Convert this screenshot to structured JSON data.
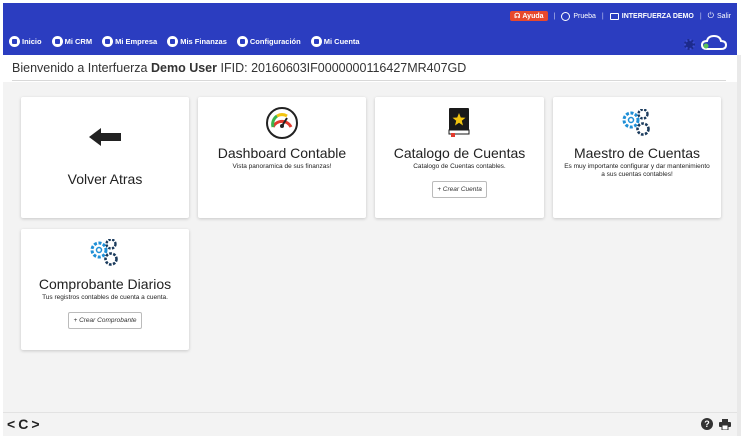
{
  "topbar": {
    "help_label": "Ayuda",
    "user_label": "Prueba",
    "company_label": "INTERFUERZA DEMO",
    "logout_label": "Salir"
  },
  "nav": {
    "items": [
      {
        "label": "Inicio"
      },
      {
        "label": "Mi CRM"
      },
      {
        "label": "Mi Empresa"
      },
      {
        "label": "Mis Finanzas"
      },
      {
        "label": "Configuración"
      },
      {
        "label": "Mi Cuenta"
      }
    ]
  },
  "welcome": {
    "prefix": "Bienvenido a Interfuerza",
    "user": "Demo User",
    "ifid_label": "IFID:",
    "ifid": "20160603IF0000000116427MR407GD"
  },
  "cards": {
    "back": {
      "title": "Volver Atras"
    },
    "dashboard": {
      "title": "Dashboard Contable",
      "subtitle": "Vista panoramica de sus finanzas!"
    },
    "catalog": {
      "title": "Catalogo de Cuentas",
      "subtitle": "Catalogo de Cuentas contables.",
      "button": "+ Crear Cuenta"
    },
    "master": {
      "title": "Maestro de Cuentas",
      "subtitle": "Es muy importante configurar y dar mantenimiento a sus cuentas contables!"
    },
    "journal": {
      "title": "Comprobante Diarios",
      "subtitle": "Tus registros contables de cuenta a cuenta.",
      "button": "+ Crear Comprobante"
    }
  },
  "bottombar": {
    "back_glyph": "<",
    "refresh_glyph": "C",
    "forward_glyph": ">",
    "help_glyph": "?"
  },
  "colors": {
    "header_bg": "#2b3dc0",
    "help_badge": "#e8482c",
    "gear_blue": "#1f8fd6"
  },
  "icons": [
    "arrow-left-icon",
    "gauge-icon",
    "book-star-icon",
    "gears-icon",
    "cloud-icon",
    "help-icon",
    "printer-icon"
  ]
}
